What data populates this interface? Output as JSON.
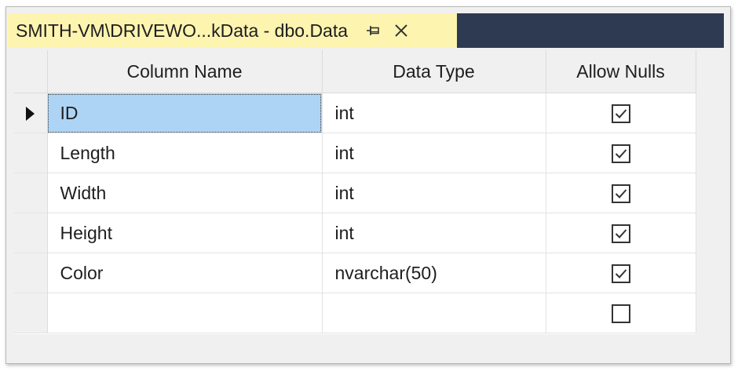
{
  "tab": {
    "title": "SMITH-VM\\DRIVEWO...kData - dbo.Data",
    "pin_icon": "pin-icon",
    "close_icon": "close-icon"
  },
  "grid": {
    "headers": {
      "column_name": "Column Name",
      "data_type": "Data Type",
      "allow_nulls": "Allow Nulls"
    },
    "rows": [
      {
        "column_name": "ID",
        "data_type": "int",
        "allow_nulls": true,
        "current": true
      },
      {
        "column_name": "Length",
        "data_type": "int",
        "allow_nulls": true
      },
      {
        "column_name": "Width",
        "data_type": "int",
        "allow_nulls": true
      },
      {
        "column_name": "Height",
        "data_type": "int",
        "allow_nulls": true
      },
      {
        "column_name": "Color",
        "data_type": "nvarchar(50)",
        "allow_nulls": true
      },
      {
        "column_name": "",
        "data_type": "",
        "allow_nulls": false
      }
    ]
  },
  "colors": {
    "tab_active": "#fdf4b0",
    "tab_strip": "#2e3a52",
    "selected_cell": "#aed4f5"
  }
}
